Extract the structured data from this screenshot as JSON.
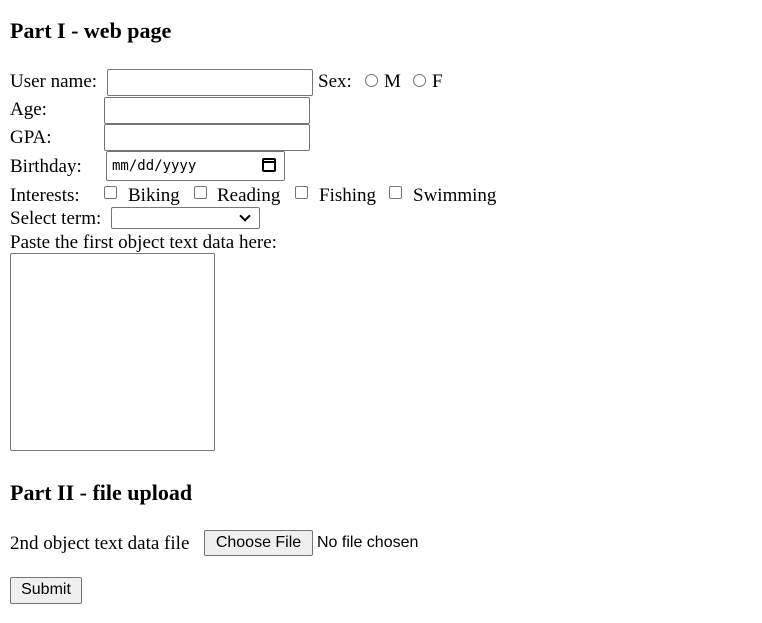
{
  "part1": {
    "heading": "Part I - web page",
    "username": {
      "label": "User name:",
      "value": ""
    },
    "sex": {
      "label": "Sex:",
      "options": [
        "M",
        "F"
      ]
    },
    "age": {
      "label": "Age:",
      "value": ""
    },
    "gpa": {
      "label": "GPA:",
      "value": ""
    },
    "birthday": {
      "label": "Birthday:",
      "placeholder": "mm/dd/yyyy"
    },
    "interests": {
      "label": "Interests:",
      "options": [
        "Biking",
        "Reading",
        "Fishing",
        "Swimming"
      ]
    },
    "term": {
      "label": "Select term:",
      "selected": ""
    },
    "paste": {
      "label": "Paste the first object text data here:",
      "value": ""
    }
  },
  "part2": {
    "heading": "Part II - file upload",
    "file_label": "2nd object text data file",
    "choose_button": "Choose File",
    "file_status": "No file chosen"
  },
  "submit_label": "Submit"
}
